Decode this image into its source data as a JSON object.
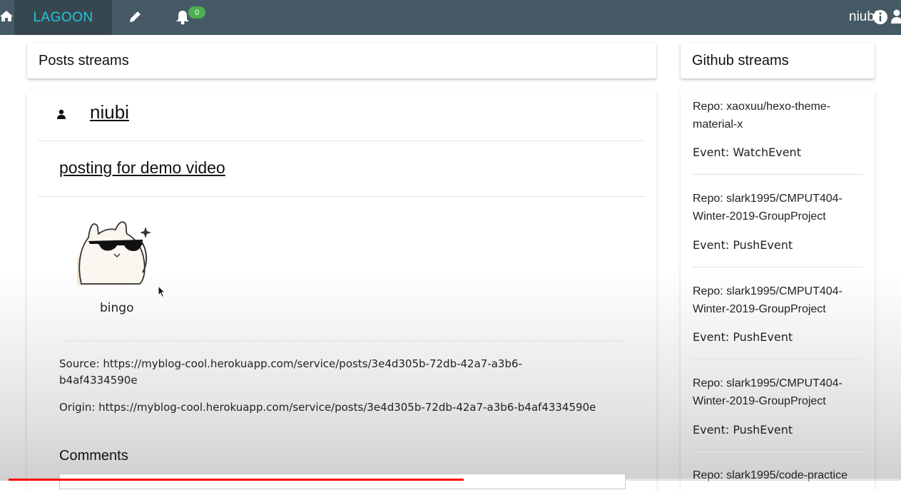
{
  "nav": {
    "brand": "LAGOON",
    "notification_count": "0",
    "username": "niubi",
    "icons": [
      "home-icon",
      "pencil-icon",
      "bell-icon",
      "info-icon",
      "user-icon"
    ]
  },
  "posts": {
    "header": "Posts streams",
    "post": {
      "author": "niubi",
      "title": "posting for demo video",
      "image_caption": "bingo",
      "source_line1": "Source: https://myblog-cool.herokuapp.com/service/posts/3e4d305b-72db-42a7-a3b6-",
      "source_line2": "b4af4334590e",
      "origin": "Origin: https://myblog-cool.herokuapp.com/service/posts/3e4d305b-72db-42a7-a3b6-b4af4334590e",
      "comments_title": "Comments"
    }
  },
  "github": {
    "header": "Github streams",
    "events": [
      {
        "repo_line1": "Repo: xaoxuu/hexo-theme-",
        "repo_line2": "material-x",
        "event": "Event: WatchEvent"
      },
      {
        "repo_line1": "Repo: slark1995/CMPUT404-",
        "repo_line2": "Winter-2019-GroupProject",
        "event": "Event: PushEvent"
      },
      {
        "repo_line1": "Repo: slark1995/CMPUT404-",
        "repo_line2": "Winter-2019-GroupProject",
        "event": "Event: PushEvent"
      },
      {
        "repo_line1": "Repo: slark1995/CMPUT404-",
        "repo_line2": "Winter-2019-GroupProject",
        "event": "Event: PushEvent"
      },
      {
        "repo_line1": "Repo: slark1995/code-practice",
        "repo_line2": "",
        "event": ""
      }
    ]
  },
  "video": {
    "progress_fraction": 0.51
  },
  "colors": {
    "navbar": "#455a64",
    "brand_bg": "#37474f",
    "brand_text": "#26c6da",
    "badge": "#4caf50",
    "progress": "#ff0000"
  }
}
